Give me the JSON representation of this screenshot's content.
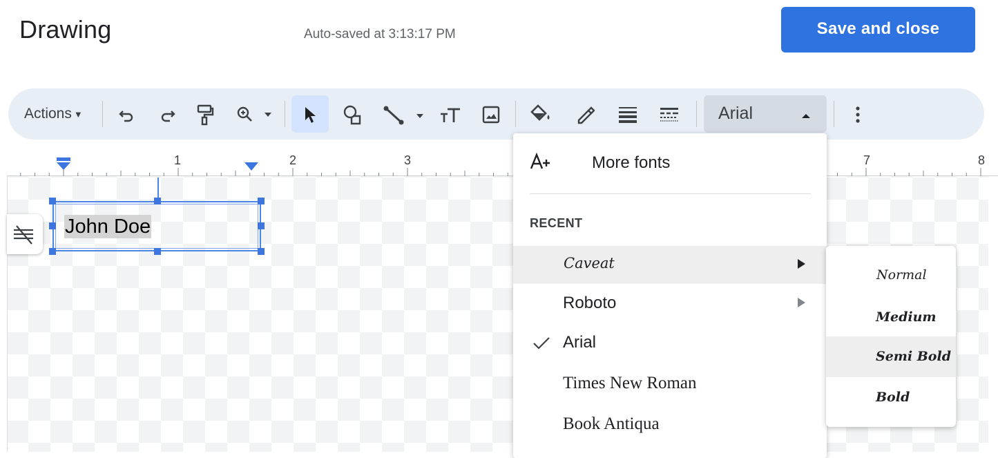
{
  "header": {
    "title": "Drawing",
    "autosave": "Auto-saved at 3:13:17 PM",
    "save_button": "Save and close"
  },
  "toolbar": {
    "actions_label": "Actions",
    "font_value": "Arial",
    "icons": [
      "undo-icon",
      "redo-icon",
      "paint-format-icon",
      "zoom-icon",
      "select-icon",
      "shape-icon",
      "line-icon",
      "text-box-icon",
      "image-icon",
      "fill-color-icon",
      "border-color-icon",
      "border-weight-icon",
      "border-dash-icon",
      "more-icon"
    ]
  },
  "ruler": {
    "numbers": [
      "1",
      "2",
      "3",
      "7",
      "8"
    ]
  },
  "canvas": {
    "text_box_content": "John Doe"
  },
  "font_menu": {
    "more_fonts": "More fonts",
    "recent_label": "RECENT",
    "items": [
      {
        "label": "Caveat",
        "submenu": true,
        "highlighted": true
      },
      {
        "label": "Roboto",
        "submenu": true
      },
      {
        "label": "Arial",
        "selected": true
      },
      {
        "label": "Times New Roman"
      },
      {
        "label": "Book Antiqua"
      }
    ]
  },
  "weight_menu": {
    "items": [
      {
        "label": "Normal"
      },
      {
        "label": "Medium"
      },
      {
        "label": "Semi Bold",
        "highlighted": true
      },
      {
        "label": "Bold"
      }
    ]
  },
  "colors": {
    "accent": "#2f73e0",
    "toolbar_bg": "#e8eef6",
    "active_tool_bg": "#d3e3fd",
    "selection": "#4a86e8"
  }
}
